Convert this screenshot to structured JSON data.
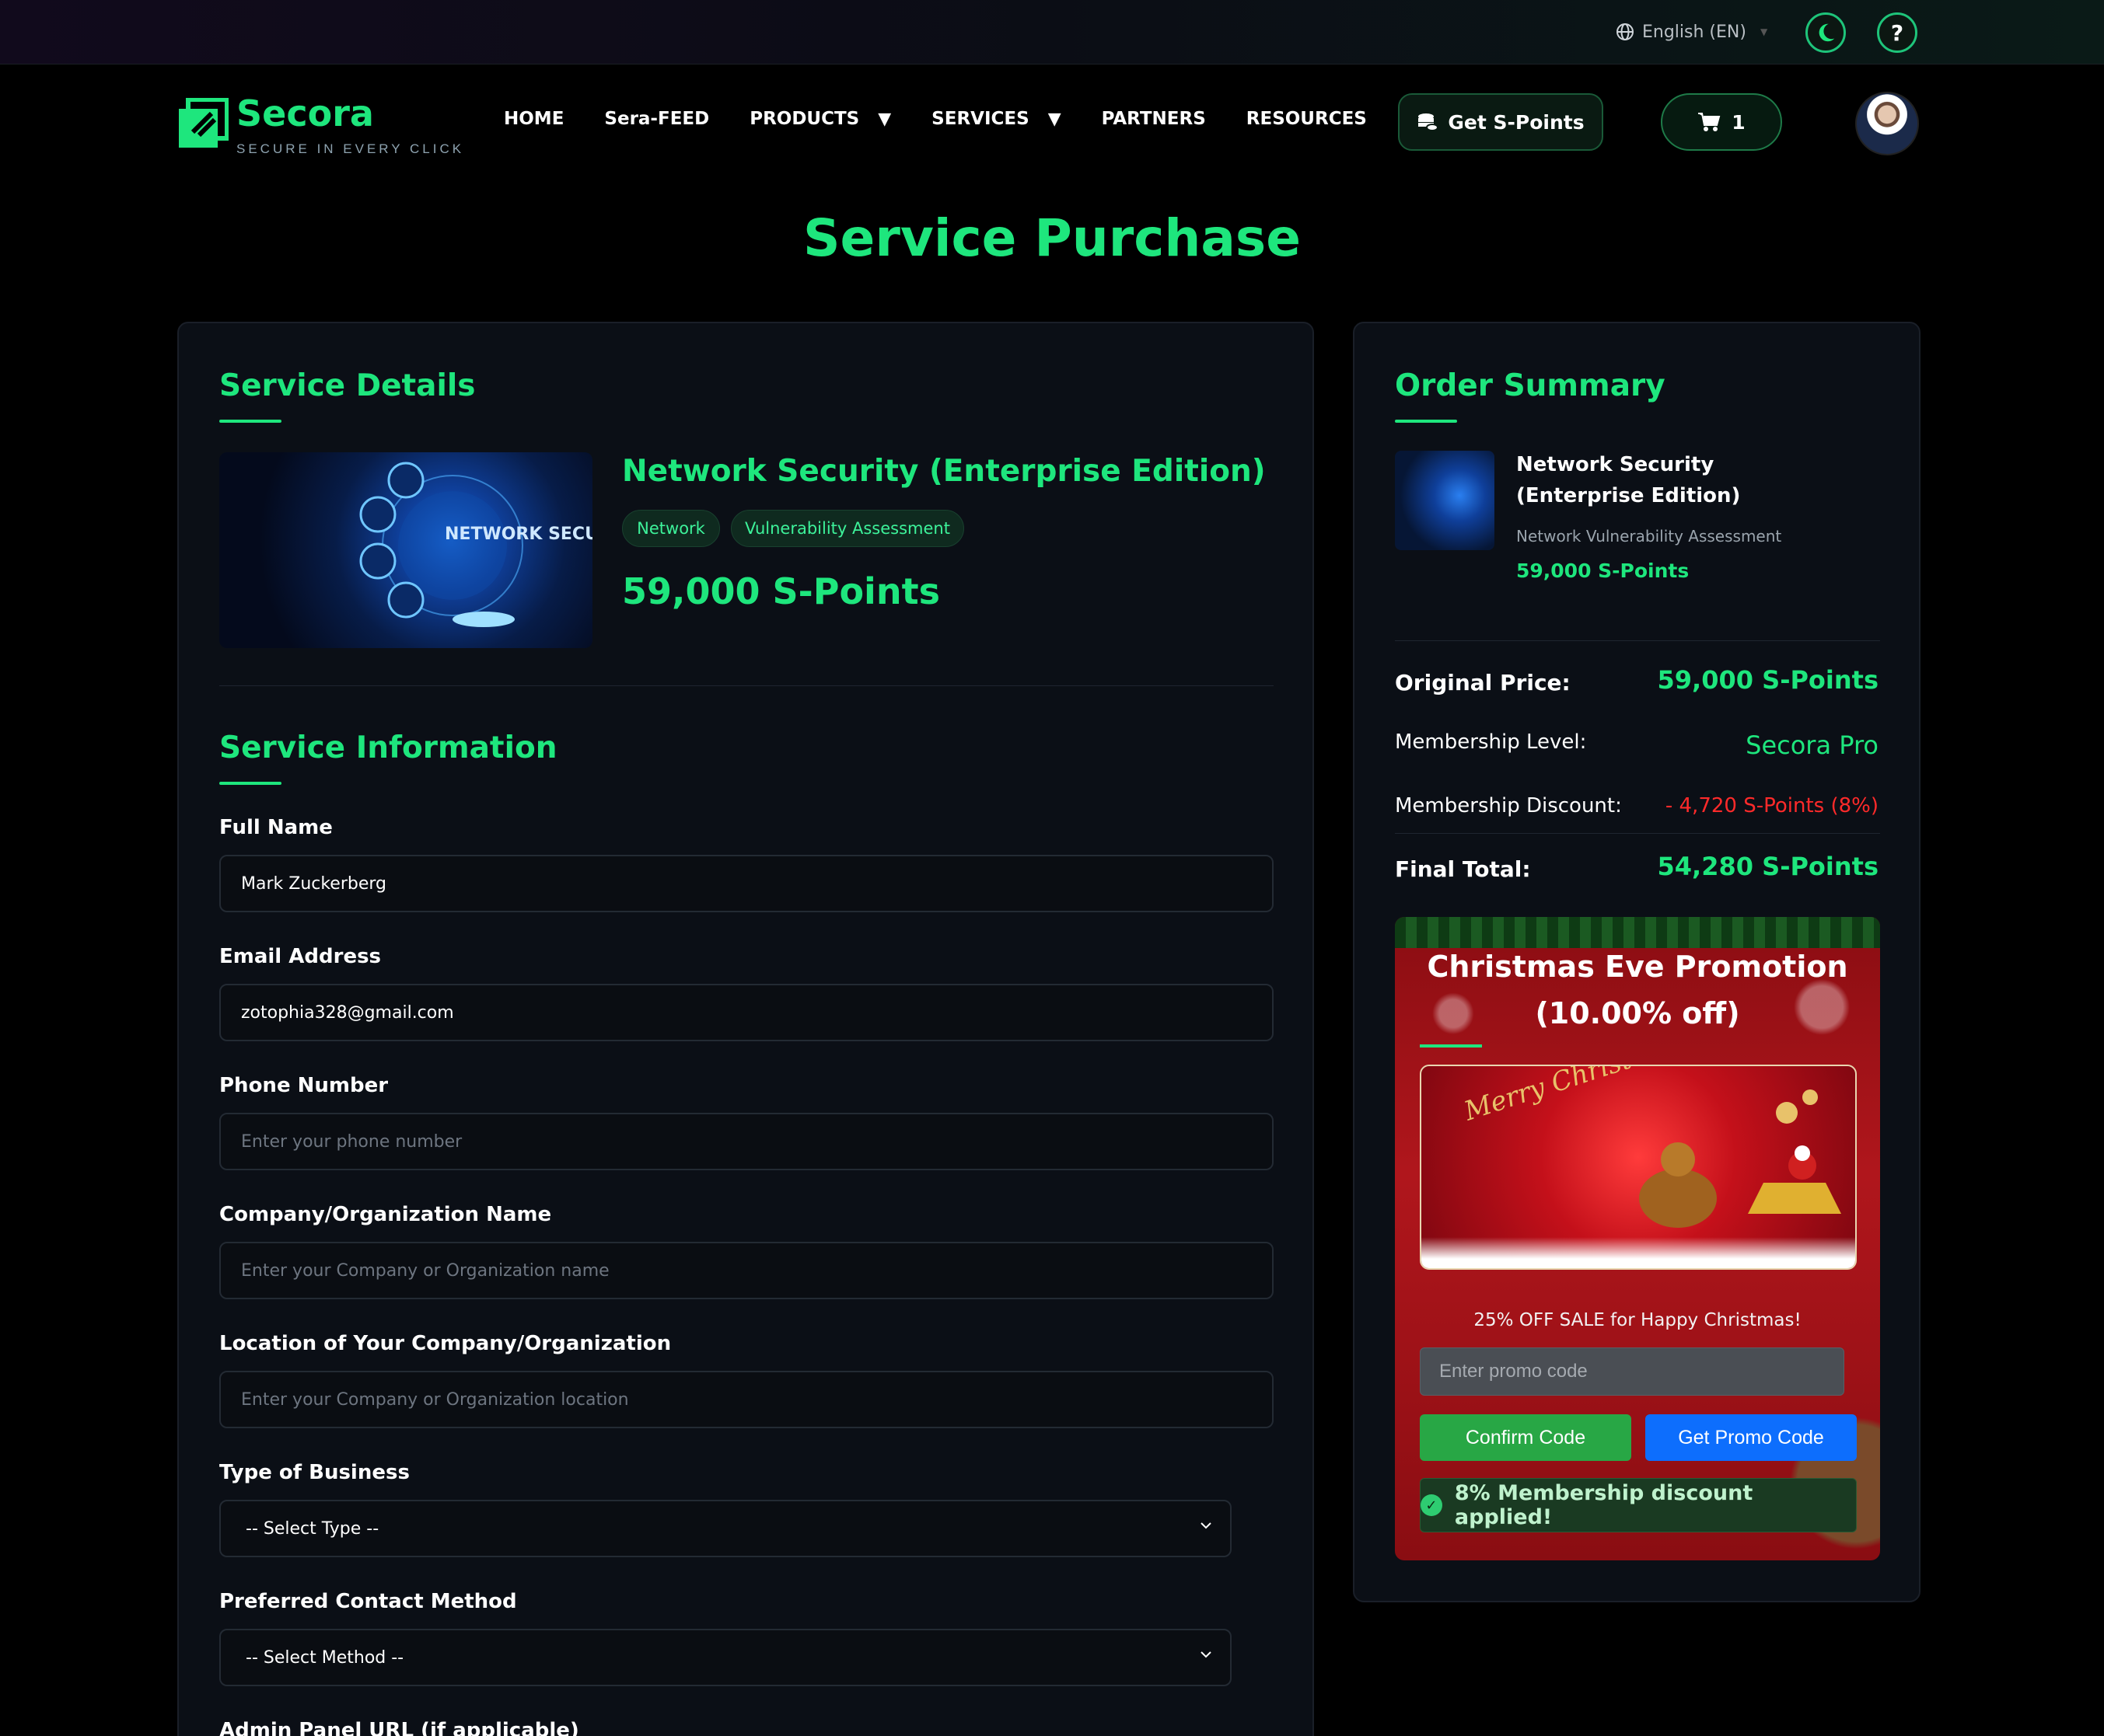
{
  "topbar": {
    "language": "English (EN)",
    "theme_toggle_icon": "moon-icon",
    "help_label": "?"
  },
  "brand": {
    "name": "Secora",
    "tagline": "SECURE IN EVERY CLICK",
    "accent": "#1ee67d"
  },
  "nav": {
    "items": [
      "HOME",
      "Sera-FEED",
      "PRODUCTS",
      "SERVICES",
      "PARTNERS",
      "RESOURCES"
    ],
    "dropdown_arrow": "▼",
    "get_points": "Get S-Points",
    "cart_count": "1"
  },
  "page": {
    "title": "Service Purchase"
  },
  "service_details": {
    "heading": "Service Details",
    "image_text": "NETWORK SECURITY",
    "name": "Network Security (Enterprise Edition)",
    "tags": [
      "Network",
      "Vulnerability Assessment"
    ],
    "price": "59,000 S-Points"
  },
  "service_information": {
    "heading": "Service Information",
    "fields": [
      {
        "label": "Full Name",
        "value": "Mark Zuckerberg",
        "placeholder": ""
      },
      {
        "label": "Email Address",
        "value": "zotophia328@gmail.com",
        "placeholder": ""
      },
      {
        "label": "Phone Number",
        "value": "",
        "placeholder": "Enter your phone number"
      },
      {
        "label": "Company/Organization Name",
        "value": "",
        "placeholder": "Enter your Company or Organization name"
      },
      {
        "label": "Location of Your Company/Organization",
        "value": "",
        "placeholder": "Enter your Company or Organization location"
      }
    ],
    "business_type": {
      "label": "Type of Business",
      "selected": "-- Select Type --"
    },
    "contact_method": {
      "label": "Preferred Contact Method",
      "selected": "-- Select Method --"
    },
    "admin_url_label": "Admin Panel URL (if applicable)"
  },
  "order_summary": {
    "heading": "Order Summary",
    "item_name": "Network Security (Enterprise Edition)",
    "item_tags": "Network  Vulnerability Assessment",
    "item_price": "59,000 S-Points",
    "original_price_label": "Original Price:",
    "original_price": "59,000 S-Points",
    "membership_level_label": "Membership Level:",
    "membership_level": "Secora Pro",
    "membership_discount_label": "Membership Discount:",
    "membership_discount": "- 4,720 S-Points (8%)",
    "final_total_label": "Final Total:",
    "final_total": "54,280 S-Points",
    "discount_color": "#ff2a2a"
  },
  "promotion": {
    "title": "Christmas Eve Promotion (10.00% off)",
    "banner_text": "Merry Christmas",
    "sale_text": "25% OFF SALE for Happy Christmas!",
    "promo_placeholder": "Enter promo code",
    "confirm_label": "Confirm Code",
    "get_code_label": "Get Promo Code",
    "applied_text": "8% Membership discount applied!",
    "confirm_color": "#28a745",
    "get_code_color": "#0d6efd"
  }
}
